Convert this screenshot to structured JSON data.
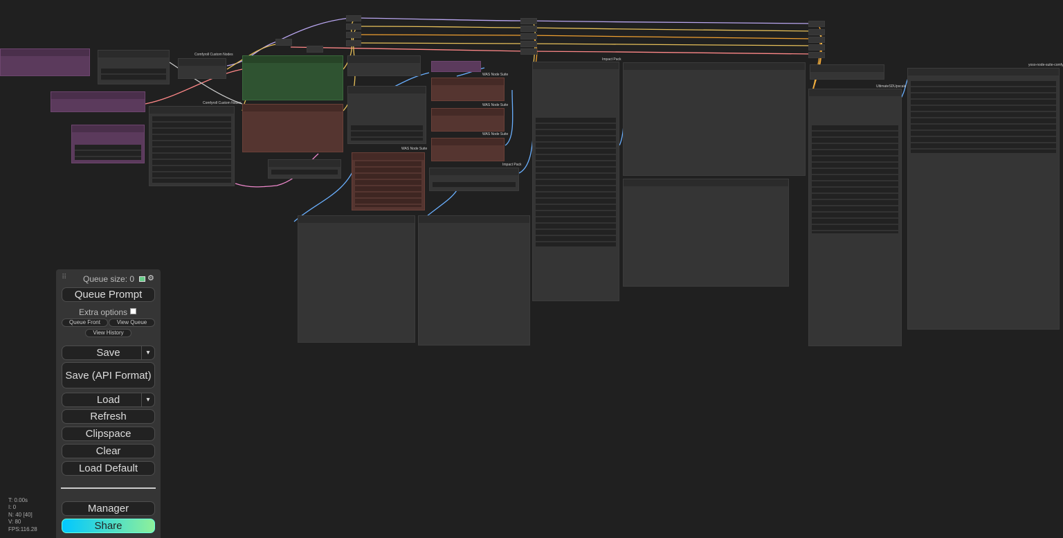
{
  "node_titles": {
    "custom_nodes_1": "Comfyroll Custom Nodes",
    "custom_nodes_2": "Comfyroll Custom Nodes",
    "was_1": "WAS Node Suite",
    "was_2": "WAS Node Suite",
    "was_3": "WAS Node Suite",
    "was_4": "WAS Node Suite",
    "impact_1": "Impact Pack",
    "impact_2": "Impact Pack",
    "ultimate_upscale": "UltimateSDUpscale",
    "yoso_suite": "yoso-node-suite-comfyui"
  },
  "menu": {
    "queue_size": "Queue size: 0",
    "queue_prompt": "Queue Prompt",
    "extra_options": "Extra options",
    "extra_options_checked": false,
    "queue_front": "Queue Front",
    "view_queue": "View Queue",
    "view_history": "View History",
    "save": "Save",
    "save_api": "Save (API Format)",
    "load": "Load",
    "refresh": "Refresh",
    "clipspace": "Clipspace",
    "clear": "Clear",
    "load_default": "Load Default",
    "manager": "Manager",
    "share": "Share",
    "dropdown_arrow": "▾"
  },
  "stats": {
    "t": "T: 0.00s",
    "i": "I: 0",
    "n": "N: 40 [40]",
    "v": "V: 80",
    "fps": "FPS:116.28"
  },
  "colors": {
    "canvas_bg": "#202020",
    "node_bg": "#353535",
    "link_yellow": "#e8c15a",
    "link_orange": "#f0a030",
    "link_purple": "#b9a6f0",
    "link_pink": "#ff8888",
    "link_blue": "#6ab0ff",
    "share_gradient_start": "#00c8ff",
    "share_gradient_end": "#8ef09a"
  }
}
